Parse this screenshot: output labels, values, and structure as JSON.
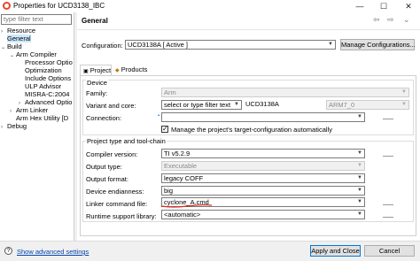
{
  "window": {
    "title": "Properties for UCD3138_IBC",
    "minimize": "—",
    "maximize": "☐",
    "close": "✕"
  },
  "sidebar": {
    "filter_placeholder": "type filter text",
    "items": [
      {
        "label": "Resource",
        "arrow": "›",
        "indent": 0,
        "selected": false
      },
      {
        "label": "General",
        "arrow": "",
        "indent": 0,
        "selected": true
      },
      {
        "label": "Build",
        "arrow": "⌄",
        "indent": 0,
        "selected": false
      },
      {
        "label": "Arm Compiler",
        "arrow": "⌄",
        "indent": 1,
        "selected": false
      },
      {
        "label": "Processor Optio",
        "arrow": "",
        "indent": 2,
        "selected": false
      },
      {
        "label": "Optimization",
        "arrow": "",
        "indent": 2,
        "selected": false
      },
      {
        "label": "Include Options",
        "arrow": "",
        "indent": 2,
        "selected": false
      },
      {
        "label": "ULP Advisor",
        "arrow": "",
        "indent": 2,
        "selected": false
      },
      {
        "label": "MISRA-C:2004",
        "arrow": "",
        "indent": 2,
        "selected": false
      },
      {
        "label": "Advanced Optio",
        "arrow": "›",
        "indent": 2,
        "selected": false
      },
      {
        "label": "Arm Linker",
        "arrow": "›",
        "indent": 1,
        "selected": false
      },
      {
        "label": "Arm Hex Utility [D",
        "arrow": "",
        "indent": 1,
        "selected": false
      },
      {
        "label": "Debug",
        "arrow": "›",
        "indent": 0,
        "selected": false
      }
    ]
  },
  "header": {
    "title": "General",
    "back": "⇦",
    "forward": "⇨",
    "menu": "⌄"
  },
  "configuration": {
    "label": "Configuration:",
    "value": "UCD3138A  [ Active ]",
    "manage_button": "Manage Configurations..."
  },
  "tabs": [
    {
      "label": "Project",
      "icon": "project-icon",
      "active": true
    },
    {
      "label": "Products",
      "icon": "products-icon",
      "active": false
    }
  ],
  "device": {
    "group_title": "Device",
    "family_label": "Family:",
    "family_value": "Arm",
    "variant_label": "Variant and core:",
    "variant_filter": "select or type filter text",
    "variant_value": "UCD3138A",
    "core_value": "ARM7_0",
    "connection_label": "Connection:",
    "connection_value": "",
    "manage_target_checkbox": "Manage the project's target-configuration automatically",
    "manage_target_checked": true
  },
  "toolchain": {
    "group_title": "Project type and tool-chain",
    "compiler_label": "Compiler version:",
    "compiler_value": "TI v5.2.9",
    "output_type_label": "Output type:",
    "output_type_value": "Executable",
    "output_format_label": "Output format:",
    "output_format_value": "legacy COFF",
    "endianness_label": "Device endianness:",
    "endianness_value": "big",
    "linker_cmd_label": "Linker command file:",
    "linker_cmd_value": "cyclone_A.cmd",
    "runtime_lib_label": "Runtime support library:",
    "runtime_lib_value": "<automatic>"
  },
  "footer": {
    "help": "?",
    "show_advanced": "Show advanced settings",
    "apply_close": "Apply and Close",
    "cancel": "Cancel"
  },
  "colors": {
    "selection": "#cce8ff",
    "annotation_underline": "#d9291c",
    "primary_border": "#0078d7"
  }
}
